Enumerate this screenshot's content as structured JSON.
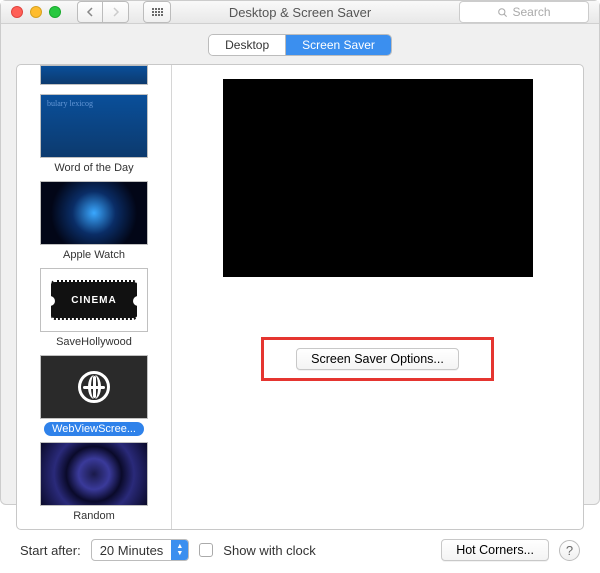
{
  "window": {
    "title": "Desktop & Screen Saver"
  },
  "search": {
    "placeholder": "Search"
  },
  "tabs": {
    "desktop": "Desktop",
    "screensaver": "Screen Saver"
  },
  "screensavers": {
    "items": [
      {
        "key": "wotd",
        "label": "Word of the Day"
      },
      {
        "key": "applewatch",
        "label": "Apple Watch"
      },
      {
        "key": "savehollywood",
        "label": "SaveHollywood"
      },
      {
        "key": "webview",
        "label": "WebViewScree..."
      },
      {
        "key": "random",
        "label": "Random"
      }
    ],
    "selected": "webview",
    "ticket_text": "CINEMA"
  },
  "buttons": {
    "options": "Screen Saver Options...",
    "hot_corners": "Hot Corners..."
  },
  "footer": {
    "start_after_label": "Start after:",
    "start_after_value": "20 Minutes",
    "show_with_clock": "Show with clock",
    "show_with_clock_checked": false
  },
  "help": "?"
}
